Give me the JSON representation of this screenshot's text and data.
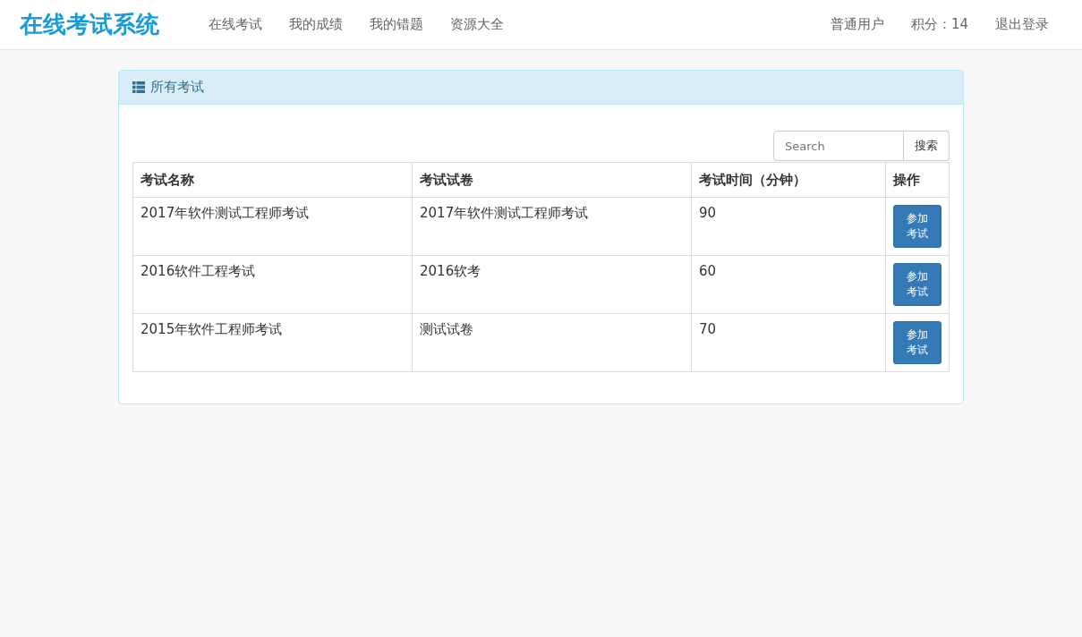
{
  "navbar": {
    "brand": "在线考试系统",
    "links": [
      "在线考试",
      "我的成绩",
      "我的错题",
      "资源大全"
    ],
    "right_links": [
      "普通用户",
      "积分：14",
      "退出登录"
    ]
  },
  "panel": {
    "title": "所有考试",
    "search": {
      "placeholder": "Search",
      "button": "搜索"
    },
    "table": {
      "columns": [
        "考试名称",
        "考试试卷",
        "考试时间（分钟）",
        "操作"
      ],
      "rows": [
        {
          "name": "2017年软件测试工程师考试",
          "paper": "2017年软件测试工程师考试",
          "time": "90",
          "action": "参加考试"
        },
        {
          "name": "2016软件工程考试",
          "paper": "2016软考",
          "time": "60",
          "action": "参加考试"
        },
        {
          "name": "2015年软件工程师考试",
          "paper": "测试试卷",
          "time": "70",
          "action": "参加考试"
        }
      ]
    }
  }
}
